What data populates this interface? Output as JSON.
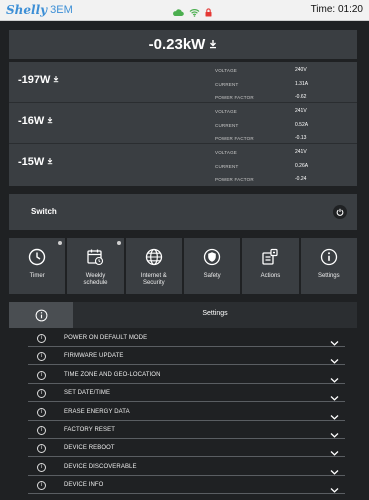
{
  "header": {
    "brand": "Shelly",
    "model": "3EM",
    "time": "Time: 01:20"
  },
  "total_power": "-0.23kW",
  "phases": [
    {
      "power": "-197W",
      "voltage_label": "VOLTAGE",
      "voltage": "240V",
      "current_label": "CURRENT",
      "current": "1.31A",
      "pf_label": "POWER FACTOR",
      "pf": "-0.62"
    },
    {
      "power": "-16W",
      "voltage_label": "VOLTAGE",
      "voltage": "241V",
      "current_label": "CURRENT",
      "current": "0.52A",
      "pf_label": "POWER FACTOR",
      "pf": "-0.13"
    },
    {
      "power": "-15W",
      "voltage_label": "VOLTAGE",
      "voltage": "241V",
      "current_label": "CURRENT",
      "current": "0.26A",
      "pf_label": "POWER FACTOR",
      "pf": "-0.24"
    }
  ],
  "switch": {
    "label": "Switch"
  },
  "tiles": [
    {
      "label": "Timer",
      "icon": "clock-icon"
    },
    {
      "label": "Weekly schedule",
      "icon": "calendar-icon"
    },
    {
      "label": "Internet & Security",
      "icon": "globe-icon"
    },
    {
      "label": "Safety",
      "icon": "shield-icon"
    },
    {
      "label": "Actions",
      "icon": "actions-icon"
    },
    {
      "label": "Settings",
      "icon": "info-icon"
    }
  ],
  "settings_header": {
    "title": "Settings"
  },
  "settings": [
    "POWER ON DEFAULT MODE",
    "FIRMWARE UPDATE",
    "TIME ZONE AND GEO-LOCATION",
    "SET DATE/TIME",
    "ERASE ENERGY DATA",
    "FACTORY RESET",
    "DEVICE REBOOT",
    "DEVICE DISCOVERABLE",
    "DEVICE INFO"
  ]
}
